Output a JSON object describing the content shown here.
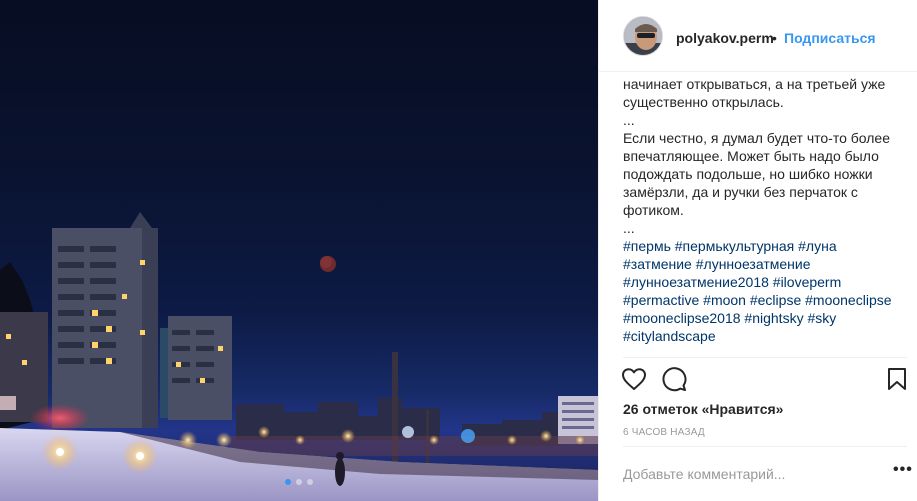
{
  "post": {
    "username": "polyakov.perm",
    "separator": "•",
    "follow_label": "Подписаться",
    "caption_lines": [
      "начинает открываться, а на третьей уже существенно открылась.",
      "...",
      "Если честно, я думал будет что-то более впечатляющее. Может быть надо было подождать подольше, но шибко ножки замёрзли, да и ручки без перчаток с фотиком.",
      "..."
    ],
    "hashtags": [
      "#пермь",
      "#пермькультурная",
      "#луна",
      "#затмение",
      "#лунноезатмение",
      "#лунноезатмение2018",
      "#iloveperm",
      "#permactive",
      "#moon",
      "#eclipse",
      "#mooneclipse",
      "#mooneclipse2018",
      "#nightsky",
      "#sky",
      "#citylandscape"
    ],
    "likes_text": "26 отметок «Нравится»",
    "time_text": "6 ЧАСОВ НАЗАД",
    "comment_placeholder": "Добавьте комментарий...",
    "more_label": "•••"
  },
  "carousel": {
    "count": 3,
    "active_index": 0
  },
  "icons": {
    "like": "heart-icon",
    "comment": "comment-bubble-icon",
    "save": "bookmark-icon",
    "more": "more-options-icon"
  },
  "colors": {
    "link": "#3897f0",
    "hashtag": "#003569",
    "text": "#262626",
    "muted": "#999999",
    "border": "#efefef"
  }
}
